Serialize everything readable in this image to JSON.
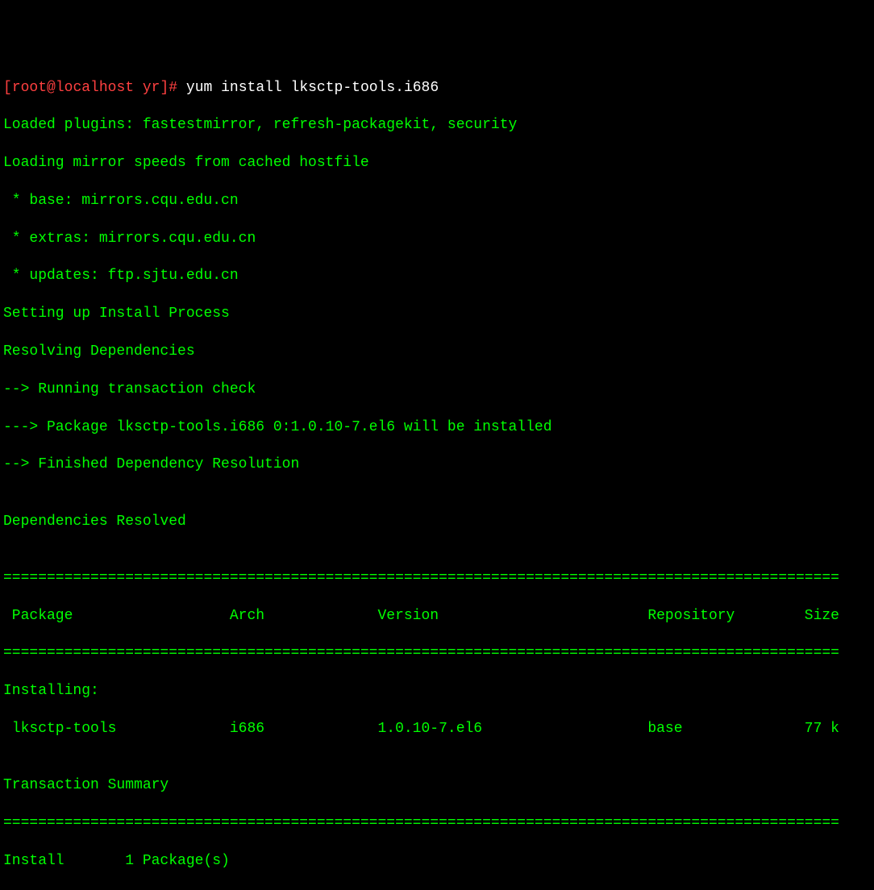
{
  "prompt": {
    "open_bracket": "[",
    "user": "root",
    "at": "@",
    "host": "localhost",
    "space": " ",
    "path": "yr",
    "close_bracket": "]",
    "hash": "# "
  },
  "command": "yum install lksctp-tools.i686",
  "output": {
    "line1": "Loaded plugins: fastestmirror, refresh-packagekit, security",
    "line2": "Loading mirror speeds from cached hostfile",
    "line3": " * base: mirrors.cqu.edu.cn",
    "line4": " * extras: mirrors.cqu.edu.cn",
    "line5": " * updates: ftp.sjtu.edu.cn",
    "line6": "Setting up Install Process",
    "line7": "Resolving Dependencies",
    "line8": "--> Running transaction check",
    "line9": "---> Package lksctp-tools.i686 0:1.0.10-7.el6 will be installed",
    "line10": "--> Finished Dependency Resolution",
    "line11": "",
    "line12": "Dependencies Resolved",
    "line13": "",
    "separator1": "================================================================================================",
    "header": " Package                  Arch             Version                        Repository        Size",
    "separator2": "================================================================================================",
    "installing": "Installing:",
    "package_row": " lksctp-tools             i686             1.0.10-7.el6                   base              77 k",
    "line_blank": "",
    "summary": "Transaction Summary",
    "separator3": "================================================================================================",
    "install_count": "Install       1 Package(s)"
  }
}
